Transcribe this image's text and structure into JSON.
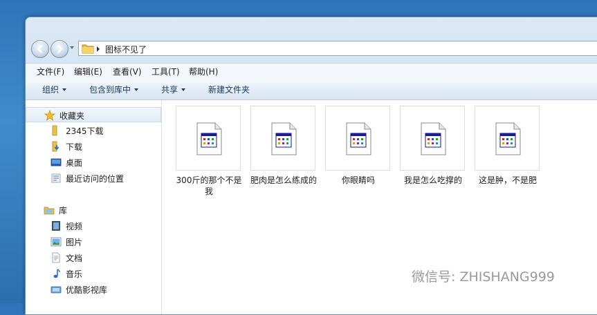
{
  "address": {
    "crumb": "图标不见了"
  },
  "menu": {
    "file": "文件(F)",
    "edit": "编辑(E)",
    "view": "查看(V)",
    "tools": "工具(T)",
    "help": "帮助(H)"
  },
  "toolbar": {
    "organize": "组织",
    "include_in_library": "包含到库中",
    "share": "共享",
    "new_folder": "新建文件夹"
  },
  "sidebar": {
    "favorites": {
      "label": "收藏夹",
      "items": [
        "2345下载",
        "下载",
        "桌面",
        "最近访问的位置"
      ]
    },
    "libraries": {
      "label": "库",
      "items": [
        "视频",
        "图片",
        "文档",
        "音乐",
        "优酷影视库"
      ]
    }
  },
  "files": [
    {
      "name": "300斤的那个不是我",
      "icon": "application-window-icon"
    },
    {
      "name": "肥肉是怎么练成的",
      "icon": "application-window-icon"
    },
    {
      "name": "你眼睛吗",
      "icon": "application-window-icon"
    },
    {
      "name": "我是怎么吃撑的",
      "icon": "application-window-icon"
    },
    {
      "name": "这是肿，不是肥",
      "icon": "application-window-icon"
    }
  ],
  "watermark": "微信号: ZHISHANG999"
}
